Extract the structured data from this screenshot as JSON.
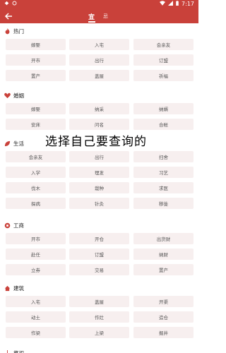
{
  "statusbar": {
    "time": "7:17"
  },
  "tabs": [
    {
      "label": "宜"
    },
    {
      "label": "忌"
    }
  ],
  "sections": [
    {
      "title": "热门",
      "icon": "fire-icon",
      "items": [
        "嫁娶",
        "入宅",
        "会亲友",
        "开市",
        "出行",
        "订盟",
        "置产",
        "盖屋",
        "祈福"
      ]
    },
    {
      "title": "婚姻",
      "icon": "heart-icon",
      "items": [
        "嫁娶",
        "纳采",
        "纳婿",
        "安床",
        "问名",
        "合帐"
      ]
    },
    {
      "title": "生活",
      "icon": "leaf-icon",
      "items": [
        "会亲友",
        "出行",
        "扫舍",
        "入学",
        "理发",
        "习艺",
        "伐木",
        "栽种",
        "求医",
        "探病",
        "针灸",
        "移徙"
      ]
    },
    {
      "title": "工商",
      "icon": "coin-icon",
      "items": [
        "开市",
        "开仓",
        "出货财",
        "赴任",
        "订盟",
        "纳财",
        "立券",
        "交易",
        "置产"
      ]
    },
    {
      "title": "建筑",
      "icon": "house-icon",
      "items": [
        "入宅",
        "盖屋",
        "开渠",
        "动土",
        "作灶",
        "造仓",
        "作梁",
        "上梁",
        "掘井"
      ]
    },
    {
      "title": "祭祀",
      "icon": "incense-icon",
      "items": []
    }
  ],
  "overlay_text": "选择自己要查询的",
  "colors": {
    "primary": "#c9413a",
    "tag_bg": "#f7efef"
  }
}
